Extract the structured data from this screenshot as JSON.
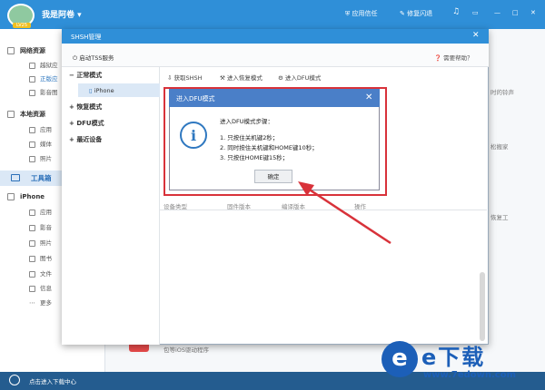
{
  "topbar": {
    "username": "我是阿卷",
    "badge": "LV25",
    "trust": "应用信任",
    "repair": "修复闪退",
    "music": "♫",
    "min": "—",
    "restore": "□",
    "close": "✕",
    "menu": "▭"
  },
  "sidebar": {
    "groups": [
      {
        "label": "网络资源",
        "items": [
          "越狱应",
          "正版应",
          "影音图"
        ]
      },
      {
        "label": "本地资源",
        "items": [
          "应用",
          "媒体",
          "照片"
        ]
      },
      {
        "label": "工具箱"
      },
      {
        "label": "iPhone",
        "items": [
          "应用",
          "影音",
          "照片",
          "图书",
          "文件",
          "信息",
          "更多"
        ]
      }
    ]
  },
  "right_bg": {
    "ringtone": "时的铃声",
    "move": "松搬家",
    "restore": "恢复工",
    "bottom_text": "包等iOS驱动程序"
  },
  "bottombar": {
    "download": "点击进入下载中心"
  },
  "shsh": {
    "title": "SHSH管理",
    "close": "✕",
    "service": "启动TSS服务",
    "help": "需要帮助？",
    "tree": {
      "normal": "正常模式",
      "device": "iPhone",
      "recovery": "恢复模式",
      "dfu": "DFU模式",
      "recent": "最近设备"
    },
    "tabs": [
      "获取SHSH",
      "进入恢复模式",
      "进入DFU模式"
    ],
    "columns": [
      "设备类型",
      "固件版本",
      "编译版本",
      "操作"
    ]
  },
  "dialog": {
    "title": "进入DFU模式",
    "close": "✕",
    "icon": "i",
    "heading": "进入DFU模式步骤：",
    "steps": [
      "1. 只按住关机键2秒；",
      "2. 同时按住关机键和HOME键10秒；",
      "3. 只按住HOME键15秒；"
    ],
    "ok": "确定"
  },
  "watermark": {
    "brand": "e下载",
    "url": "www.7edown.com"
  },
  "colors": {
    "accent": "#2f8fd8",
    "highlight": "#d8323a",
    "dialog_header": "#4a7fc8"
  }
}
